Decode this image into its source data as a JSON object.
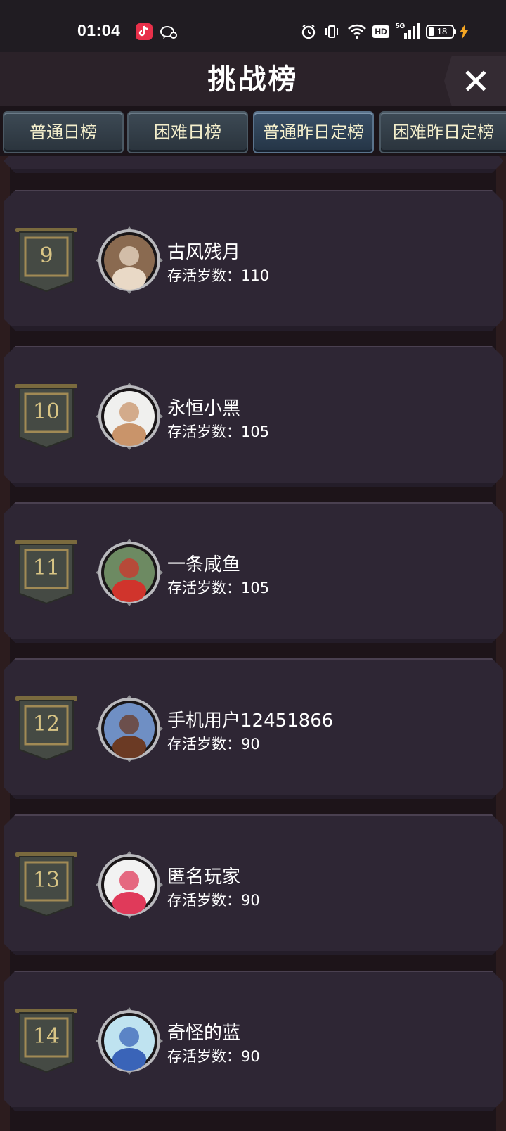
{
  "status_bar": {
    "time": "01:04",
    "network": "5G",
    "hd": "HD",
    "battery": "18",
    "icons": [
      "tiktok-icon",
      "chat-icon",
      "alarm-icon",
      "vibrate-icon",
      "wifi-icon",
      "hd-icon",
      "signal-icon",
      "battery-icon",
      "charging-icon"
    ]
  },
  "header": {
    "title": "挑战榜",
    "close_icon": "close-icon"
  },
  "tabs": [
    {
      "label": "普通日榜",
      "active": false
    },
    {
      "label": "困难日榜",
      "active": false
    },
    {
      "label": "普通昨日定榜",
      "active": true
    },
    {
      "label": "困难昨日定榜",
      "active": false
    }
  ],
  "leaderboard": {
    "entries": [
      {
        "rank": "9",
        "name": "古风残月",
        "score": "存活岁数：110",
        "avatar": "avatar-anime-girl-brown-hair",
        "colors": [
          "#8a6a50",
          "#e9d9c6"
        ]
      },
      {
        "rank": "10",
        "name": "永恒小黑",
        "score": "存活岁数：105",
        "avatar": "avatar-bear",
        "colors": [
          "#f0f0ee",
          "#c9946a"
        ]
      },
      {
        "rank": "11",
        "name": "一条咸鱼",
        "score": "存活岁数：105",
        "avatar": "avatar-shiba-dog",
        "colors": [
          "#6d8a62",
          "#d0342c"
        ]
      },
      {
        "rank": "12",
        "name": "手机用户12451866",
        "score": "存活岁数：90",
        "avatar": "avatar-anime-soldier",
        "colors": [
          "#6f8fc4",
          "#6b3a24"
        ]
      },
      {
        "rank": "13",
        "name": "匿名玩家",
        "score": "存活岁数：90",
        "avatar": "avatar-anime-white-hair",
        "colors": [
          "#f2f2f2",
          "#e03a5a"
        ]
      },
      {
        "rank": "14",
        "name": "奇怪的蓝",
        "score": "存活岁数：90",
        "avatar": "avatar-anime-blue-girl",
        "colors": [
          "#bfe3f0",
          "#3a64b8"
        ]
      }
    ]
  }
}
